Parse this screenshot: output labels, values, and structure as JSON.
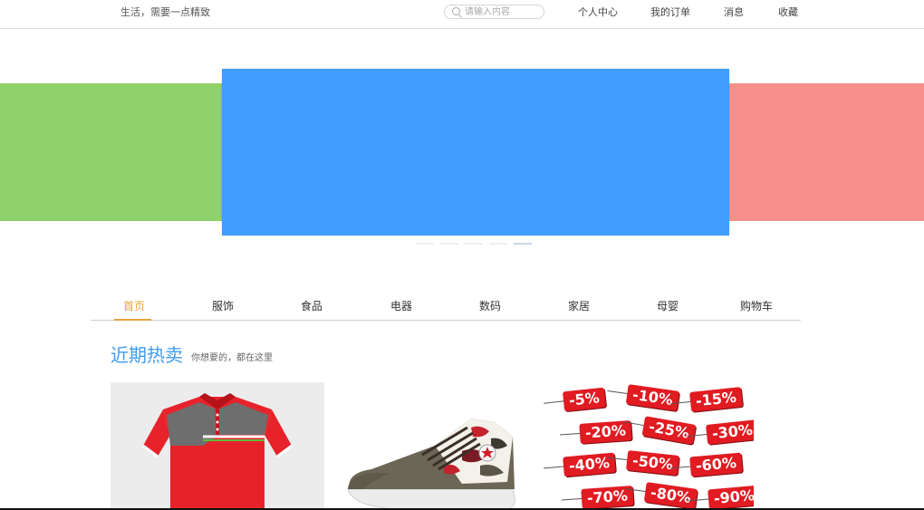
{
  "topbar": {
    "slogan": "生活，需要一点精致",
    "search_placeholder": "请输入内容",
    "links": [
      "个人中心",
      "我的订单",
      "消息",
      "收藏"
    ]
  },
  "banner": {
    "colors": {
      "left": "#8fd16a",
      "main": "#409eff",
      "right": "#f78f8b"
    },
    "indicator_count": 5,
    "active_index": 4
  },
  "nav": {
    "items": [
      "首页",
      "服饰",
      "食品",
      "电器",
      "数码",
      "家居",
      "母婴",
      "购物车"
    ],
    "active_index": 0,
    "accent_color": "#e8a33a"
  },
  "section": {
    "title": "近期热卖",
    "subtitle": "你想要的，都在这里",
    "title_color": "#3f9cf0"
  },
  "products": [
    {
      "name": "red-polo-shirt",
      "icon": "polo-shirt-image"
    },
    {
      "name": "camo-sneaker",
      "icon": "sneaker-image"
    },
    {
      "name": "discount-tags",
      "icon": "sale-tags-image",
      "tags": [
        "-5%",
        "-10%",
        "-15%",
        "-20%",
        "-25%",
        "-30%",
        "-40%",
        "-50%",
        "-60%",
        "-70%",
        "-80%",
        "-90%"
      ]
    }
  ]
}
